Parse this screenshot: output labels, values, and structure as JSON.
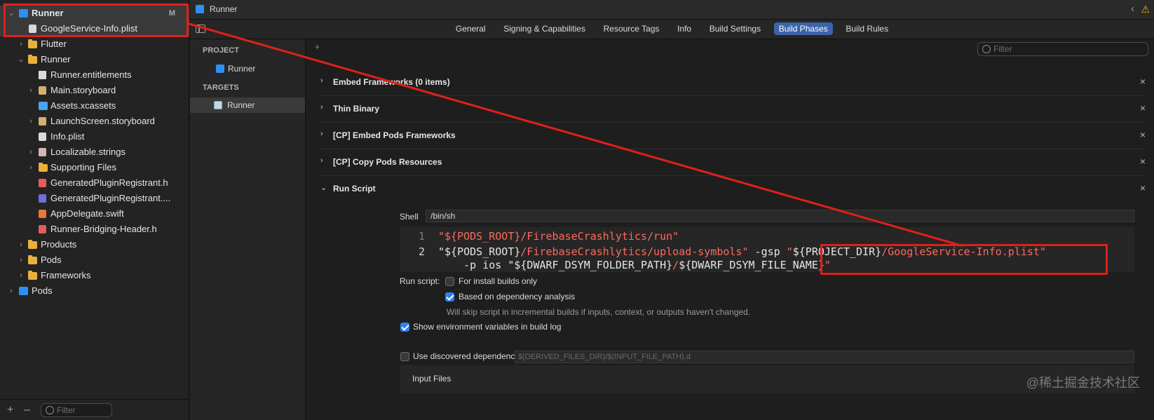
{
  "navigator": {
    "items": [
      {
        "label": "Runner",
        "badge": "M"
      },
      {
        "label": "GoogleService-Info.plist"
      },
      {
        "label": "Flutter"
      },
      {
        "label": "Runner"
      },
      {
        "label": "Runner.entitlements"
      },
      {
        "label": "Main.storyboard"
      },
      {
        "label": "Assets.xcassets"
      },
      {
        "label": "LaunchScreen.storyboard"
      },
      {
        "label": "Info.plist"
      },
      {
        "label": "Localizable.strings"
      },
      {
        "label": "Supporting Files"
      },
      {
        "label": "GeneratedPluginRegistrant.h"
      },
      {
        "label": "GeneratedPluginRegistrant...."
      },
      {
        "label": "AppDelegate.swift"
      },
      {
        "label": "Runner-Bridging-Header.h"
      },
      {
        "label": "Products"
      },
      {
        "label": "Pods"
      },
      {
        "label": "Frameworks"
      },
      {
        "label": "Pods"
      }
    ],
    "bottom": {
      "plus": "+",
      "minus": "–",
      "filter_placeholder": "Filter"
    }
  },
  "topbar": {
    "title": "Runner",
    "back": "‹",
    "warning": "⚠"
  },
  "tabs": [
    {
      "label": "General"
    },
    {
      "label": "Signing & Capabilities"
    },
    {
      "label": "Resource Tags"
    },
    {
      "label": "Info"
    },
    {
      "label": "Build Settings"
    },
    {
      "label": "Build Phases"
    },
    {
      "label": "Build Rules"
    }
  ],
  "targets_pane": {
    "project_header": "PROJECT",
    "project_item": "Runner",
    "targets_header": "TARGETS",
    "target_item": "Runner"
  },
  "main": {
    "add": "+",
    "filter_placeholder": "Filter",
    "phases": [
      {
        "title": "Embed Frameworks (0 items)",
        "expanded": false,
        "close": "×"
      },
      {
        "title": "Thin Binary",
        "expanded": false,
        "close": "×"
      },
      {
        "title": "[CP] Embed Pods Frameworks",
        "expanded": false,
        "close": "×"
      },
      {
        "title": "[CP] Copy Pods Resources",
        "expanded": false,
        "close": "×"
      },
      {
        "title": "Run Script",
        "expanded": true,
        "close": "×"
      }
    ],
    "shell_label": "Shell",
    "shell_value": "/bin/sh",
    "code_lines": [
      {
        "num": "1"
      },
      {
        "num": "2"
      }
    ],
    "code": {
      "l1_var": "\"${PODS_ROOT}",
      "l1_str": "/FirebaseCrashlytics/run\"",
      "l2_var": "\"${PODS_ROOT}",
      "l2_str": "/FirebaseCrashlytics/upload-symbols\"",
      "l2_flag": " -gsp ",
      "l2_q": "\"",
      "l2_var2": "${PROJECT_DIR}",
      "l2_str2": "/GoogleService-Info.plist\"",
      "l3_a": "    -p ios ",
      "l3_var": "\"${DWARF_DSYM_FOLDER_PATH}",
      "l3_mid": "/",
      "l3_var2": "${DWARF_DSYM_FILE_NAME}",
      "l3_end": "\""
    },
    "run_script_label": "Run script:",
    "opt_install": "For install builds only",
    "opt_dependency": "Based on dependency analysis",
    "dependency_note": "Will skip script in incremental builds if inputs, context, or outputs haven't changed.",
    "opt_env": "Show environment variables in build log",
    "opt_discovered": "Use discovered dependency file:",
    "dep_file_placeholder": "$(DERIVED_FILES_DIR)/$(INPUT_FILE_PATH).d",
    "input_files": "Input Files",
    "checkbox_state": {
      "install": false,
      "dependency": true,
      "env": true,
      "discovered": false
    }
  },
  "watermark": "@稀土掘金技术社区",
  "colors": {
    "annotation": "#e0201a",
    "selected_tab": "#3b64a8",
    "string": "#fc6a5d",
    "checkbox": "#2f7ff5"
  }
}
